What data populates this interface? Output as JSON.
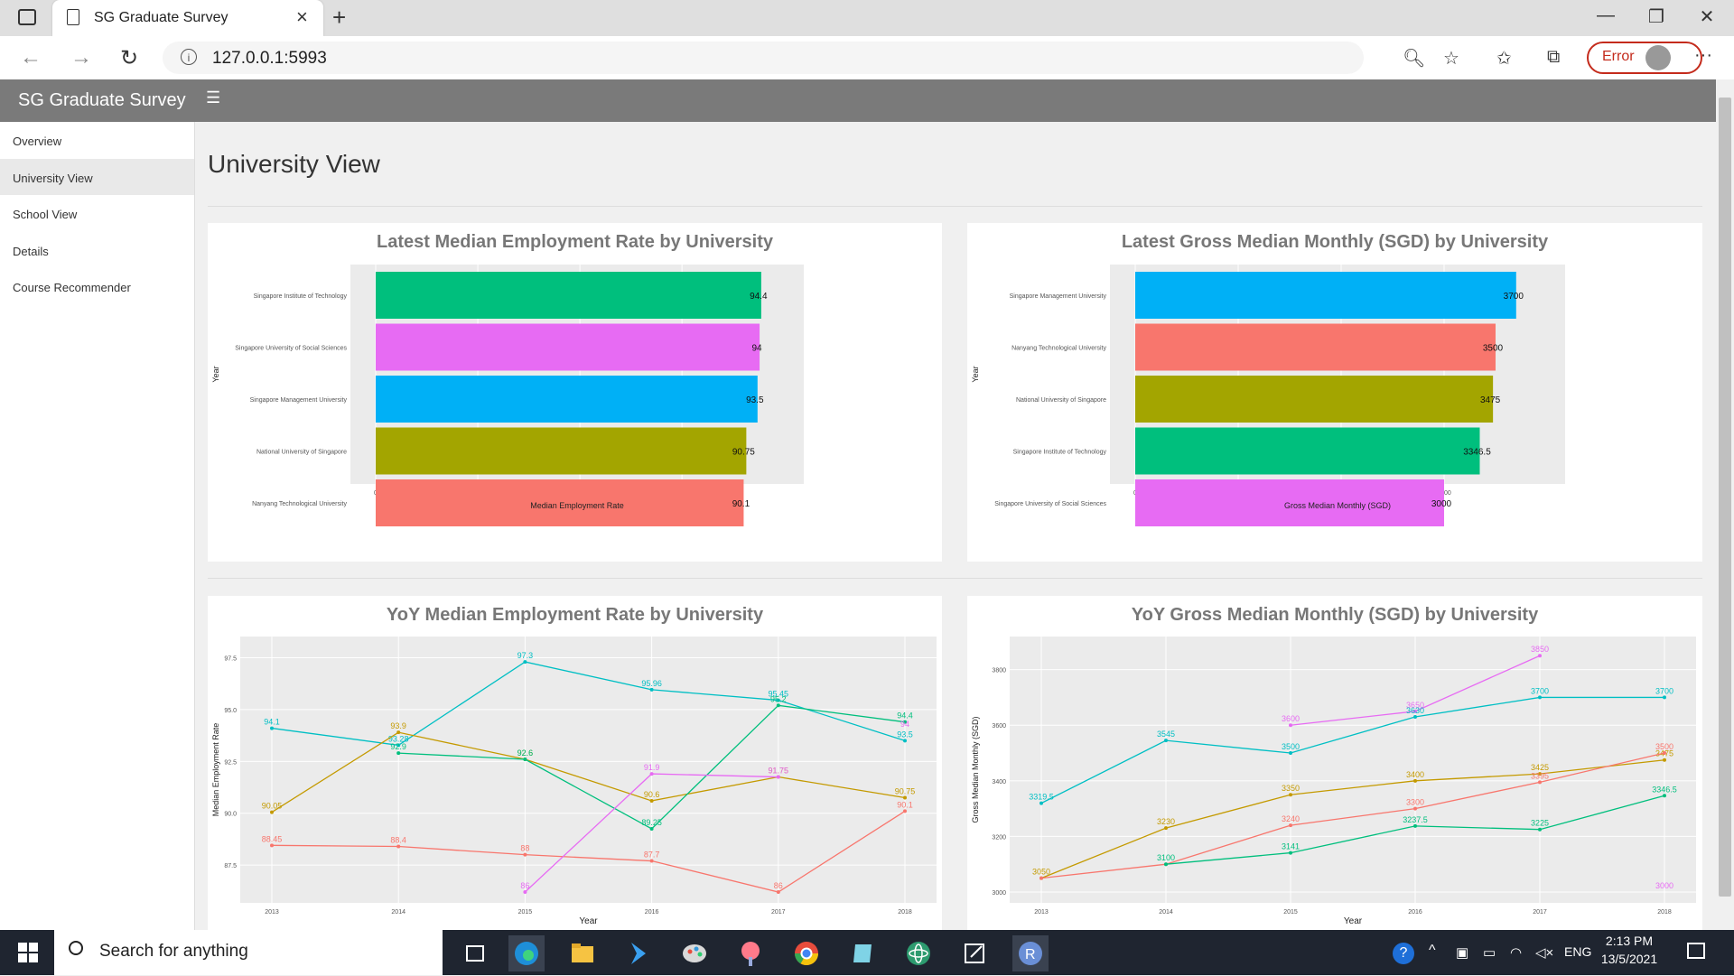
{
  "browser": {
    "tab_title": "SG Graduate Survey",
    "url": "127.0.0.1:5993",
    "profile_status": "Error"
  },
  "app": {
    "title": "SG Graduate Survey",
    "page_title": "University View",
    "nav": [
      {
        "label": "Overview",
        "active": false
      },
      {
        "label": "University View",
        "active": true
      },
      {
        "label": "School View",
        "active": false
      },
      {
        "label": "Details",
        "active": false
      },
      {
        "label": "Course Recommender",
        "active": false
      }
    ]
  },
  "taskbar": {
    "search_placeholder": "Search for anything",
    "language": "ENG",
    "time": "2:13 PM",
    "date": "13/5/2021"
  },
  "colors": {
    "Singapore Institute of Technology": "#00BF7D",
    "Singapore University of Social Sciences": "#E76BF3",
    "Singapore Management University": "#00B0F6",
    "National University of Singapore": "#A3A500",
    "Nanyang Technological University": "#F8766D",
    "line_sit": "#00BF7D",
    "line_suss": "#E76BF3",
    "line_smu": "#00BFC4",
    "line_nus": "#C49A00",
    "line_ntu": "#F8766D"
  },
  "chart_data": [
    {
      "type": "bar",
      "title": "Latest Median Employment Rate by University",
      "xlabel": "Median Employment Rate",
      "ylabel": "Year",
      "categories": [
        "Singapore Institute of Technology",
        "Singapore University of Social Sciences",
        "Singapore Management University",
        "National University of Singapore",
        "Nanyang Technological University"
      ],
      "values": [
        94.4,
        94,
        93.5,
        90.75,
        90.1
      ],
      "labels": [
        "94.4",
        "94",
        "93.5",
        "90.75",
        "90.1"
      ],
      "xlim": [
        0,
        100
      ],
      "ticks": [
        0,
        25,
        50,
        75
      ]
    },
    {
      "type": "bar",
      "title": "Latest Gross Median Monthly (SGD) by University",
      "xlabel": "Gross Median Monthly (SGD)",
      "ylabel": "Year",
      "categories": [
        "Singapore Management University",
        "Nanyang Technological University",
        "National University of Singapore",
        "Singapore Institute of Technology",
        "Singapore University of Social Sciences"
      ],
      "values": [
        3700,
        3500,
        3475,
        3346.5,
        3000
      ],
      "labels": [
        "3700",
        "3500",
        "3475",
        "3346.5",
        "3000"
      ],
      "xlim": [
        0,
        3900
      ],
      "ticks": [
        0,
        1000,
        2000,
        3000
      ]
    },
    {
      "type": "line",
      "title": "YoY Median Employment Rate by University",
      "xlabel": "Year",
      "ylabel": "Median Employment Rate",
      "x": [
        2013,
        2014,
        2015,
        2016,
        2017,
        2018
      ],
      "ylim": [
        86.2,
        98
      ],
      "yticks": [
        "87.5",
        "90.0",
        "92.5",
        "95.0",
        "97.5"
      ],
      "series": [
        {
          "color_key": "line_smu",
          "values": [
            94.1,
            93.28,
            97.3,
            95.96,
            95.45,
            93.5
          ],
          "labels": [
            "94.1",
            "93.28",
            "97.3",
            "95.96",
            "95.45",
            "93.5"
          ]
        },
        {
          "color_key": "line_nus",
          "values": [
            90.05,
            93.9,
            92.6,
            90.6,
            91.75,
            90.75
          ],
          "labels": [
            "90.05",
            "93.9",
            "92.6",
            "90.6",
            "91.75",
            "90.75"
          ]
        },
        {
          "color_key": "line_sit",
          "values": [
            null,
            92.9,
            92.6,
            89.25,
            95.2,
            94.4
          ],
          "labels": [
            "",
            "92.9",
            "92.6",
            "89.25",
            "95.2",
            "94.4"
          ]
        },
        {
          "color_key": "line_ntu",
          "values": [
            88.45,
            88.4,
            88,
            87.7,
            86.2,
            90.1
          ],
          "labels": [
            "88.45",
            "88.4",
            "88",
            "87.7",
            "86",
            "90.1"
          ]
        },
        {
          "color_key": "line_suss",
          "values": [
            null,
            null,
            86.2,
            91.9,
            91.75,
            null
          ],
          "labels": [
            "",
            "",
            "86",
            "91.9",
            "91.75",
            ""
          ]
        }
      ],
      "extra_labels": [
        {
          "x": 2018,
          "y": 94,
          "text": "94",
          "color_key": "line_suss"
        }
      ]
    },
    {
      "type": "line",
      "title": "YoY Gross Median Monthly (SGD) by University",
      "xlabel": "Year",
      "ylabel": "Gross Median Monthly (SGD)",
      "x": [
        2013,
        2014,
        2015,
        2016,
        2017,
        2018
      ],
      "ylim": [
        3000,
        3880
      ],
      "yticks": [
        "3000",
        "3200",
        "3400",
        "3600",
        "3800"
      ],
      "series": [
        {
          "color_key": "line_suss",
          "values": [
            null,
            null,
            3600,
            3650,
            3850,
            null
          ],
          "labels": [
            "",
            "",
            "3600",
            "3650",
            "3850",
            ""
          ]
        },
        {
          "color_key": "line_smu",
          "values": [
            3319.5,
            3545,
            3500,
            3630,
            3700,
            3700
          ],
          "labels": [
            "3319.5",
            "3545",
            "3500",
            "3630",
            "3700",
            "3700"
          ]
        },
        {
          "color_key": "line_nus",
          "values": [
            3050,
            3230,
            3350,
            3400,
            3425,
            3475
          ],
          "labels": [
            "3050",
            "3230",
            "3350",
            "3400",
            "3425",
            "3475"
          ]
        },
        {
          "color_key": "line_ntu",
          "values": [
            3050,
            3100,
            3240,
            3300,
            3395,
            3500
          ],
          "labels": [
            "",
            "",
            "3240",
            "3300",
            "3395",
            "3500"
          ]
        },
        {
          "color_key": "line_sit",
          "values": [
            null,
            3100,
            3141,
            3237.5,
            3225,
            3346.5
          ],
          "labels": [
            "",
            "3100",
            "3141",
            "3237.5",
            "3225",
            "3346.5"
          ]
        }
      ],
      "extra_labels": [
        {
          "x": 2018,
          "y": 3000,
          "text": "3000",
          "color_key": "line_suss"
        }
      ]
    }
  ]
}
